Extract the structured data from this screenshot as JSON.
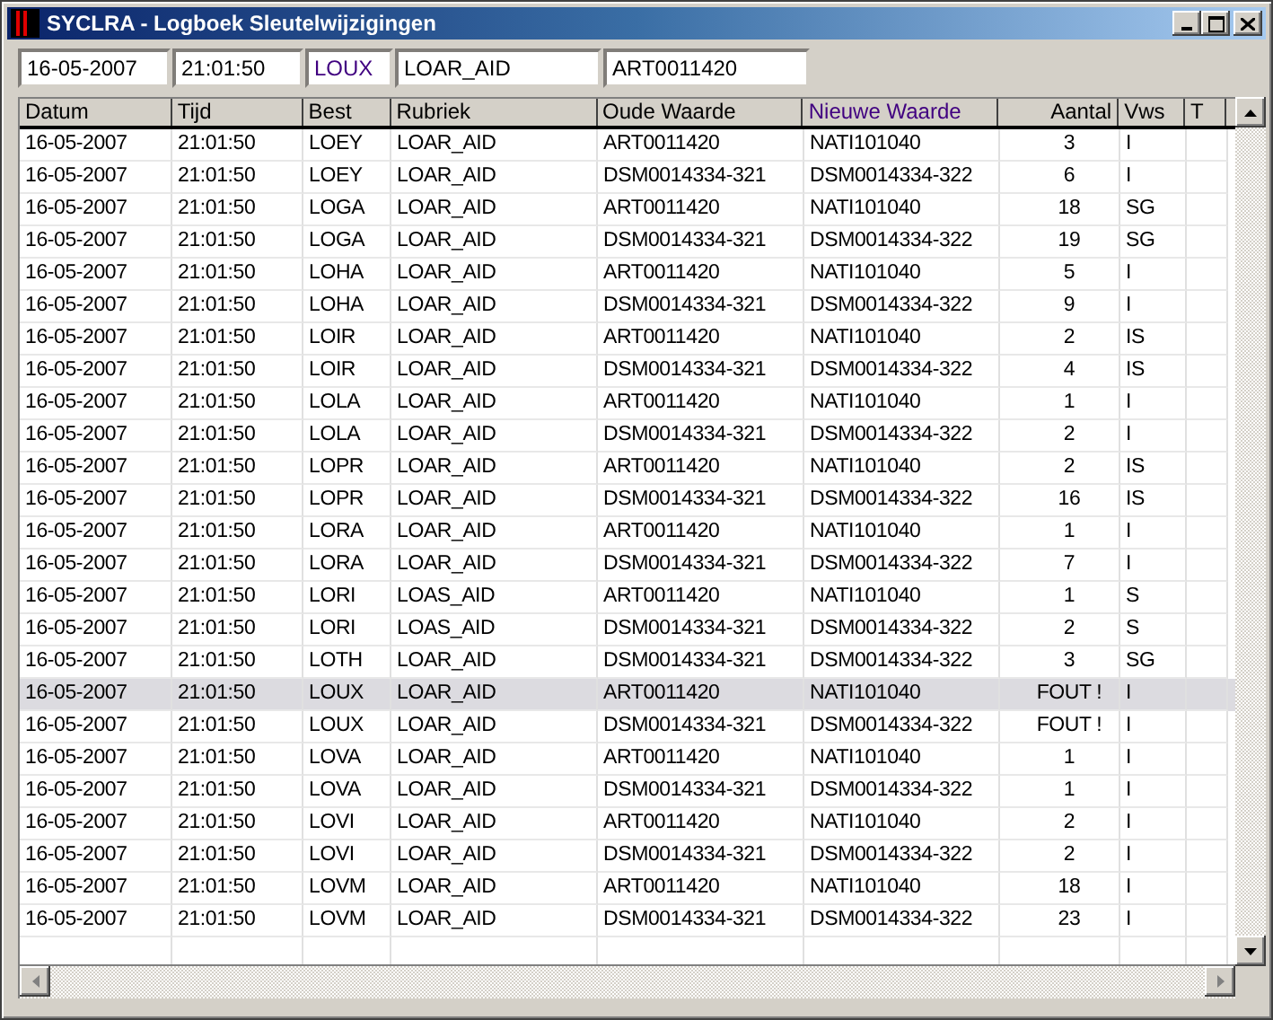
{
  "window": {
    "title": "SYCLRA - Logboek Sleutelwijzigingen"
  },
  "filter": {
    "datum": "16-05-2007",
    "tijd": "21:01:50",
    "best": "LOUX",
    "rubriek": "LOAR_AID",
    "oude_waarde": "ART0011420"
  },
  "table": {
    "columns": [
      "Datum",
      "Tijd",
      "Best",
      "Rubriek",
      "Oude Waarde",
      "Nieuwe Waarde",
      "Aantal",
      "Vws",
      "T"
    ],
    "rows": [
      {
        "datum": "16-05-2007",
        "tijd": "21:01:50",
        "best": "LOEY",
        "rubriek": "LOAR_AID",
        "oude_waarde": "ART0011420",
        "nieuwe_waarde": "NATI101040",
        "aantal": "3",
        "vws": "I",
        "selected": false
      },
      {
        "datum": "16-05-2007",
        "tijd": "21:01:50",
        "best": "LOEY",
        "rubriek": "LOAR_AID",
        "oude_waarde": "DSM0014334-321",
        "nieuwe_waarde": "DSM0014334-322",
        "aantal": "6",
        "vws": "I",
        "selected": false
      },
      {
        "datum": "16-05-2007",
        "tijd": "21:01:50",
        "best": "LOGA",
        "rubriek": "LOAR_AID",
        "oude_waarde": "ART0011420",
        "nieuwe_waarde": "NATI101040",
        "aantal": "18",
        "vws": "SG",
        "selected": false
      },
      {
        "datum": "16-05-2007",
        "tijd": "21:01:50",
        "best": "LOGA",
        "rubriek": "LOAR_AID",
        "oude_waarde": "DSM0014334-321",
        "nieuwe_waarde": "DSM0014334-322",
        "aantal": "19",
        "vws": "SG",
        "selected": false
      },
      {
        "datum": "16-05-2007",
        "tijd": "21:01:50",
        "best": "LOHA",
        "rubriek": "LOAR_AID",
        "oude_waarde": "ART0011420",
        "nieuwe_waarde": "NATI101040",
        "aantal": "5",
        "vws": "I",
        "selected": false
      },
      {
        "datum": "16-05-2007",
        "tijd": "21:01:50",
        "best": "LOHA",
        "rubriek": "LOAR_AID",
        "oude_waarde": "DSM0014334-321",
        "nieuwe_waarde": "DSM0014334-322",
        "aantal": "9",
        "vws": "I",
        "selected": false
      },
      {
        "datum": "16-05-2007",
        "tijd": "21:01:50",
        "best": "LOIR",
        "rubriek": "LOAR_AID",
        "oude_waarde": "ART0011420",
        "nieuwe_waarde": "NATI101040",
        "aantal": "2",
        "vws": "IS",
        "selected": false
      },
      {
        "datum": "16-05-2007",
        "tijd": "21:01:50",
        "best": "LOIR",
        "rubriek": "LOAR_AID",
        "oude_waarde": "DSM0014334-321",
        "nieuwe_waarde": "DSM0014334-322",
        "aantal": "4",
        "vws": "IS",
        "selected": false
      },
      {
        "datum": "16-05-2007",
        "tijd": "21:01:50",
        "best": "LOLA",
        "rubriek": "LOAR_AID",
        "oude_waarde": "ART0011420",
        "nieuwe_waarde": "NATI101040",
        "aantal": "1",
        "vws": "I",
        "selected": false
      },
      {
        "datum": "16-05-2007",
        "tijd": "21:01:50",
        "best": "LOLA",
        "rubriek": "LOAR_AID",
        "oude_waarde": "DSM0014334-321",
        "nieuwe_waarde": "DSM0014334-322",
        "aantal": "2",
        "vws": "I",
        "selected": false
      },
      {
        "datum": "16-05-2007",
        "tijd": "21:01:50",
        "best": "LOPR",
        "rubriek": "LOAR_AID",
        "oude_waarde": "ART0011420",
        "nieuwe_waarde": "NATI101040",
        "aantal": "2",
        "vws": "IS",
        "selected": false
      },
      {
        "datum": "16-05-2007",
        "tijd": "21:01:50",
        "best": "LOPR",
        "rubriek": "LOAR_AID",
        "oude_waarde": "DSM0014334-321",
        "nieuwe_waarde": "DSM0014334-322",
        "aantal": "16",
        "vws": "IS",
        "selected": false
      },
      {
        "datum": "16-05-2007",
        "tijd": "21:01:50",
        "best": "LORA",
        "rubriek": "LOAR_AID",
        "oude_waarde": "ART0011420",
        "nieuwe_waarde": "NATI101040",
        "aantal": "1",
        "vws": "I",
        "selected": false
      },
      {
        "datum": "16-05-2007",
        "tijd": "21:01:50",
        "best": "LORA",
        "rubriek": "LOAR_AID",
        "oude_waarde": "DSM0014334-321",
        "nieuwe_waarde": "DSM0014334-322",
        "aantal": "7",
        "vws": "I",
        "selected": false
      },
      {
        "datum": "16-05-2007",
        "tijd": "21:01:50",
        "best": "LORI",
        "rubriek": "LOAS_AID",
        "oude_waarde": "ART0011420",
        "nieuwe_waarde": "NATI101040",
        "aantal": "1",
        "vws": "S",
        "selected": false
      },
      {
        "datum": "16-05-2007",
        "tijd": "21:01:50",
        "best": "LORI",
        "rubriek": "LOAS_AID",
        "oude_waarde": "DSM0014334-321",
        "nieuwe_waarde": "DSM0014334-322",
        "aantal": "2",
        "vws": "S",
        "selected": false
      },
      {
        "datum": "16-05-2007",
        "tijd": "21:01:50",
        "best": "LOTH",
        "rubriek": "LOAR_AID",
        "oude_waarde": "DSM0014334-321",
        "nieuwe_waarde": "DSM0014334-322",
        "aantal": "3",
        "vws": "SG",
        "selected": false
      },
      {
        "datum": "16-05-2007",
        "tijd": "21:01:50",
        "best": "LOUX",
        "rubriek": "LOAR_AID",
        "oude_waarde": "ART0011420",
        "nieuwe_waarde": "NATI101040",
        "aantal": "FOUT !",
        "vws": "I",
        "selected": true
      },
      {
        "datum": "16-05-2007",
        "tijd": "21:01:50",
        "best": "LOUX",
        "rubriek": "LOAR_AID",
        "oude_waarde": "DSM0014334-321",
        "nieuwe_waarde": "DSM0014334-322",
        "aantal": "FOUT !",
        "vws": "I",
        "selected": false
      },
      {
        "datum": "16-05-2007",
        "tijd": "21:01:50",
        "best": "LOVA",
        "rubriek": "LOAR_AID",
        "oude_waarde": "ART0011420",
        "nieuwe_waarde": "NATI101040",
        "aantal": "1",
        "vws": "I",
        "selected": false
      },
      {
        "datum": "16-05-2007",
        "tijd": "21:01:50",
        "best": "LOVA",
        "rubriek": "LOAR_AID",
        "oude_waarde": "DSM0014334-321",
        "nieuwe_waarde": "DSM0014334-322",
        "aantal": "1",
        "vws": "I",
        "selected": false
      },
      {
        "datum": "16-05-2007",
        "tijd": "21:01:50",
        "best": "LOVI",
        "rubriek": "LOAR_AID",
        "oude_waarde": "ART0011420",
        "nieuwe_waarde": "NATI101040",
        "aantal": "2",
        "vws": "I",
        "selected": false
      },
      {
        "datum": "16-05-2007",
        "tijd": "21:01:50",
        "best": "LOVI",
        "rubriek": "LOAR_AID",
        "oude_waarde": "DSM0014334-321",
        "nieuwe_waarde": "DSM0014334-322",
        "aantal": "2",
        "vws": "I",
        "selected": false
      },
      {
        "datum": "16-05-2007",
        "tijd": "21:01:50",
        "best": "LOVM",
        "rubriek": "LOAR_AID",
        "oude_waarde": "ART0011420",
        "nieuwe_waarde": "NATI101040",
        "aantal": "18",
        "vws": "I",
        "selected": false
      },
      {
        "datum": "16-05-2007",
        "tijd": "21:01:50",
        "best": "LOVM",
        "rubriek": "LOAR_AID",
        "oude_waarde": "DSM0014334-321",
        "nieuwe_waarde": "DSM0014334-322",
        "aantal": "23",
        "vws": "I",
        "selected": false
      }
    ]
  }
}
